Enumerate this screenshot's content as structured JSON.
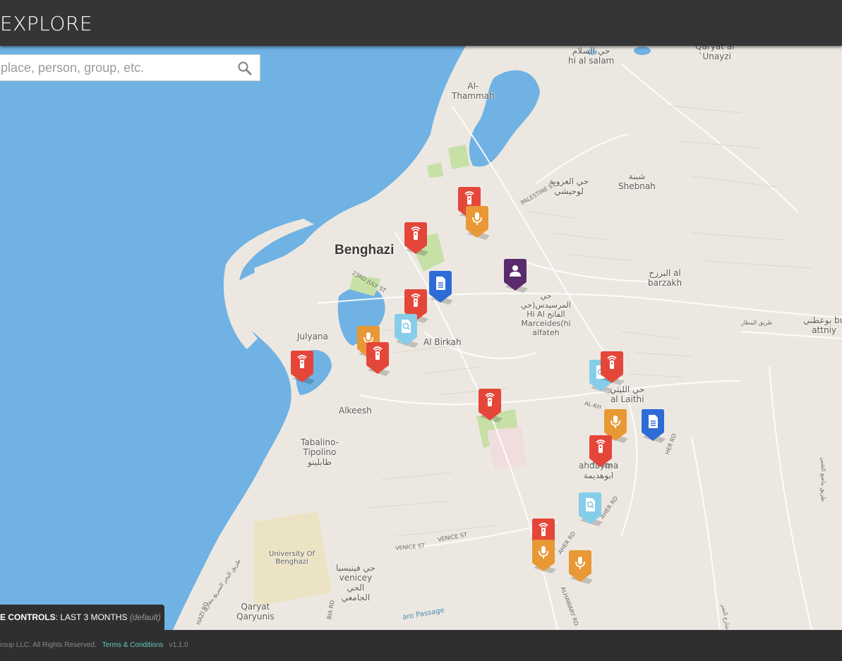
{
  "header": {
    "title": "EXPLORE"
  },
  "search": {
    "placeholder": "place, person, group, etc."
  },
  "map": {
    "labels": {
      "city": "Benghazi",
      "hi_al_salam": "حي السلام\nhi al salam",
      "qaryat_unayzi": "Qaryat al\n`Unayzi",
      "al_thammah": "Al-\nThammah",
      "shebnah": "شبنة\nShebnah",
      "hay_al_orouba": "حي العروبة\nلوحيشي",
      "al_barzakh": "البرزخ al\nbarzakh",
      "marceides": "حي\nالمرسيدس(حي\nHi Al الفاتح\nMarceides(hi\nalfateh",
      "al_birkah": "Al Birkah",
      "julyana": "Julyana",
      "alkeesh": "Alkeesh",
      "al_laithi": "حي الليثي\nal Laithi",
      "tabalino": "Tabalino-\nTipolino\nطابلينو",
      "hadayma": "ahdayma\nابوهديمة",
      "university": "University Of\nBenghazi",
      "venicey": "حي فينيسيا\nvenicey\nالحي\nالجامعي",
      "qaryunis": "Qaryat\nQaryunis",
      "bu_attniy": "بوعطني bu\nattniy",
      "venice_st_1": "VENICE ST",
      "venice_st_2": "VENICE ST",
      "palestine_st": "PALESTINE ST",
      "july_st": "23RD JULY ST",
      "al_khalij": "AL-KH",
      "gamal_rd": "HER RD",
      "alhawary_rd": "ALHAWARY RD",
      "aher_rd_1": "AHER RD",
      "aher_rd_2": "AHER RD",
      "airport_rd": "طريق المطار",
      "passage": "aro Passage",
      "abia_rd": "BIA RD",
      "hazi_rd": "HAZI RD",
      "sahel_rd": "طريق البحر السريع بنغازي",
      "east_rd_1": "طريق ماصع الشين",
      "east_rd_2": "شارع الشر"
    },
    "markers": [
      {
        "name": "signal-marker-1",
        "type": "signal",
        "color": "#e5463a"
      },
      {
        "name": "audio-marker-1",
        "type": "audio",
        "color": "#e89834"
      },
      {
        "name": "signal-marker-2",
        "type": "signal",
        "color": "#e5463a"
      },
      {
        "name": "document-marker-1",
        "type": "document",
        "color": "#2d6bd6"
      },
      {
        "name": "person-marker-1",
        "type": "person",
        "color": "#5a2a6e"
      },
      {
        "name": "signal-marker-3",
        "type": "signal",
        "color": "#e5463a"
      },
      {
        "name": "search-marker-1",
        "type": "search",
        "color": "#86cdea"
      },
      {
        "name": "audio-marker-2",
        "type": "audio",
        "color": "#e89834"
      },
      {
        "name": "signal-marker-4",
        "type": "signal",
        "color": "#e5463a"
      },
      {
        "name": "signal-marker-5",
        "type": "signal",
        "color": "#e5463a"
      },
      {
        "name": "signal-marker-6",
        "type": "signal",
        "color": "#e5463a"
      },
      {
        "name": "search-marker-2",
        "type": "search",
        "color": "#86cdea"
      },
      {
        "name": "signal-marker-7",
        "type": "signal",
        "color": "#e5463a"
      },
      {
        "name": "audio-marker-3",
        "type": "audio",
        "color": "#e89834"
      },
      {
        "name": "document-marker-2",
        "type": "document",
        "color": "#2d6bd6"
      },
      {
        "name": "signal-marker-8",
        "type": "signal",
        "color": "#e5463a"
      },
      {
        "name": "search-marker-3",
        "type": "search",
        "color": "#86cdea"
      },
      {
        "name": "signal-marker-9",
        "type": "signal",
        "color": "#e5463a"
      },
      {
        "name": "audio-marker-4",
        "type": "audio",
        "color": "#e89834"
      },
      {
        "name": "audio-marker-5",
        "type": "audio",
        "color": "#e89834"
      }
    ],
    "colors": {
      "sea": "#6fb2e3",
      "land": "#ece8e1",
      "park": "#c7e0a6"
    }
  },
  "time_controls": {
    "label": "E CONTROLS",
    "value": ": LAST 3 MONTHS ",
    "note": "(default)"
  },
  "footer": {
    "copyright": "roup LLC. All Rights Reserved.",
    "terms": "Terms & Conditions",
    "version": "v1.1.0"
  }
}
